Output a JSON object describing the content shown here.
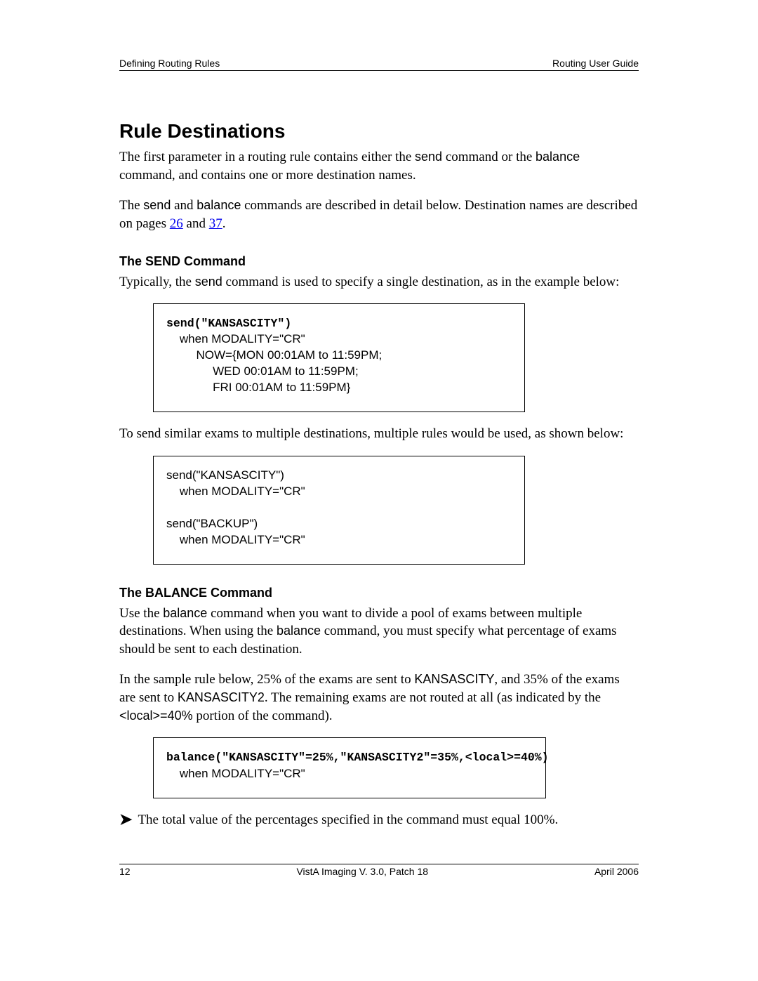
{
  "header": {
    "left": "Defining Routing Rules",
    "right": "Routing User Guide"
  },
  "footer": {
    "left": "12",
    "center": "VistA Imaging V. 3.0, Patch 18",
    "right": "April 2006"
  },
  "h1": "Rule Destinations",
  "intro": {
    "p1_a": "The first parameter in a routing rule contains either the ",
    "p1_send": "send",
    "p1_b": " command or the ",
    "p1_balance": "balance",
    "p1_c": " command, and contains one or more destination names.",
    "p2_a": "The ",
    "p2_send": "send",
    "p2_b": " and ",
    "p2_balance": "balance",
    "p2_c": " commands are described in detail below.  Destination names are described on pages ",
    "link1": "26",
    "p2_d": " and ",
    "link2": "37",
    "p2_e": "."
  },
  "send": {
    "heading": "The SEND Command",
    "p1_a": "Typically, the ",
    "p1_send": "send",
    "p1_b": " command is used to specify a single destination, as in the example below:",
    "code1_bold": "send(\"KANSASCITY\")",
    "code1_rest": "\n    when MODALITY=\"CR\"\n         NOW={MON 00:01AM to 11:59PM;\n              WED 00:01AM to 11:59PM;\n              FRI 00:01AM to 11:59PM}",
    "p2": "To send similar exams to multiple destinations, multiple rules would be used, as shown below:",
    "code2": "send(\"KANSASCITY\")\n    when MODALITY=\"CR\"\n\nsend(\"BACKUP\")\n    when MODALITY=\"CR\""
  },
  "balance": {
    "heading": "The BALANCE Command",
    "p1_a": "Use the ",
    "p1_bal": "balance",
    "p1_b": " command when you want to divide a pool of exams between multiple destinations. When using the ",
    "p1_bal2": "balance",
    "p1_c": " command, you must specify what percentage of exams should be sent to each destination.",
    "p2_a": "In the sample rule below, 25% of the exams are sent to ",
    "p2_kc": "KANSASCITY",
    "p2_b": ", and 35% of the exams are sent to ",
    "p2_kc2": "KANSASCITY2",
    "p2_c": ". The remaining exams are not routed at all (as indicated by the ",
    "p2_local": "<local>=40%",
    "p2_d": " portion of the command).",
    "code_bold": "balance(\"KANSASCITY\"=25%,\"KANSASCITY2\"=35%,<local>=40%)",
    "code_rest": "\n    when MODALITY=\"CR\"",
    "note_icon": "➤",
    "note": "The total value of the percentages specified in the command must equal 100%."
  }
}
